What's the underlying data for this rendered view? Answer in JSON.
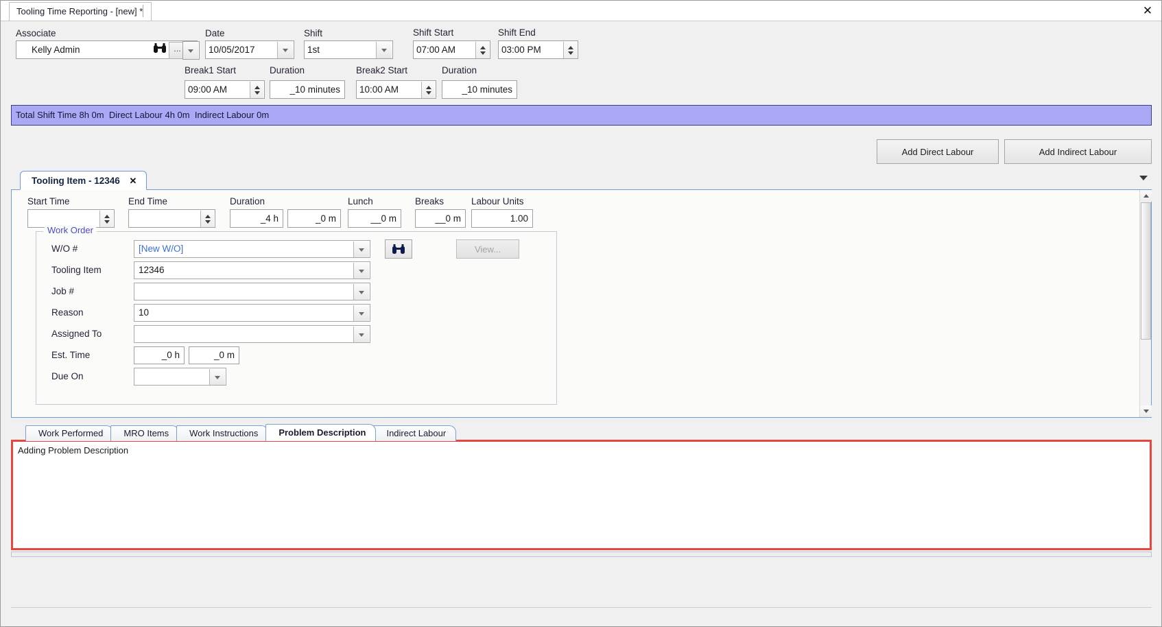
{
  "window": {
    "document_tab_title": "Tooling Time Reporting - [new] *",
    "close_label": "✕"
  },
  "header": {
    "associate": {
      "label": "Associate",
      "value": "Kelly Admin",
      "search_icon": "binoculars-icon",
      "ellipsis_label": "...",
      "dropdown_icon": "chevron-down-icon"
    },
    "date": {
      "label": "Date",
      "value": "10/05/2017"
    },
    "shift": {
      "label": "Shift",
      "value": "1st"
    },
    "shift_start": {
      "label": "Shift Start",
      "value": "07:00 AM"
    },
    "shift_end": {
      "label": "Shift End",
      "value": "03:00 PM"
    },
    "break1_start": {
      "label": "Break1 Start",
      "value": "09:00 AM"
    },
    "break1_duration": {
      "label": "Duration",
      "value": "_10 minutes"
    },
    "break2_start": {
      "label": "Break2 Start",
      "value": "10:00 AM"
    },
    "break2_duration": {
      "label": "Duration",
      "value": "_10 minutes"
    }
  },
  "summary": {
    "text": "Total Shift Time 8h 0m  Direct Labour 4h 0m  Indirect Labour 0m"
  },
  "actions": {
    "add_direct_labour": "Add Direct Labour",
    "add_indirect_labour": "Add Indirect Labour"
  },
  "tooling_tab": {
    "label": "Tooling Item - 12346",
    "close": "✕",
    "collapse_icon": "chevron-down-icon"
  },
  "time_row": {
    "start_time": {
      "label": "Start Time",
      "value": ""
    },
    "end_time": {
      "label": "End Time",
      "value": ""
    },
    "duration": {
      "label": "Duration",
      "hours": "_4 h",
      "minutes": "_0 m"
    },
    "lunch": {
      "label": "Lunch",
      "value": "__0 m"
    },
    "breaks": {
      "label": "Breaks",
      "value": "__0 m"
    },
    "labour_units": {
      "label": "Labour Units",
      "value": "1.00"
    }
  },
  "work_order": {
    "legend": "Work Order",
    "wo_number": {
      "label": "W/O #",
      "value": "[New W/O]"
    },
    "search_icon": "binoculars-icon",
    "view_button": "View...",
    "tooling_item": {
      "label": "Tooling Item",
      "value": "12346"
    },
    "job_number": {
      "label": "Job #",
      "value": ""
    },
    "reason": {
      "label": "Reason",
      "value": "10"
    },
    "assigned_to": {
      "label": "Assigned To",
      "value": ""
    },
    "est_time": {
      "label": "Est. Time",
      "hours": "_0 h",
      "minutes": "_0 m"
    },
    "due_on": {
      "label": "Due On",
      "value": ""
    }
  },
  "bottom_tabs": [
    {
      "label": "Work Performed",
      "active": false
    },
    {
      "label": "MRO Items",
      "active": false
    },
    {
      "label": "Work Instructions",
      "active": false
    },
    {
      "label": "Problem Description",
      "active": true
    },
    {
      "label": "Indirect Labour",
      "active": false
    }
  ],
  "problem_description": {
    "text": "Adding Problem Description"
  },
  "colors": {
    "summary_bar": "#a9a9f5",
    "highlight_border": "#e8453c",
    "tab_border": "#6f9ad4",
    "link_text": "#3b6ed8",
    "legend_text": "#4a4ad0"
  }
}
